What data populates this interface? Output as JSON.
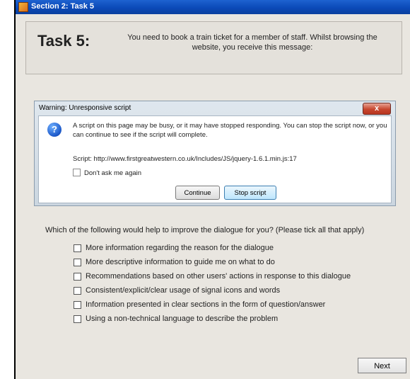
{
  "window": {
    "title": "Section 2: Task 5",
    "icon": "app-icon"
  },
  "task": {
    "label": "Task 5:",
    "description": "You need to book a train ticket for a member of staff.  Whilst browsing the website, you receive this message:"
  },
  "dialog": {
    "title": "Warning: Unresponsive script",
    "close_label": "x",
    "icon": "question-icon",
    "message": "A script on this page may be busy, or it may have stopped responding. You can stop the script now, or you can continue to see if the script will complete.",
    "script_line": "Script: http://www.firstgreatwestern.co.uk/Includes/JS/jquery-1.6.1.min.js:17",
    "dont_ask_label": "Don't ask me again",
    "dont_ask_checked": false,
    "continue_label": "Continue",
    "stop_label": "Stop script"
  },
  "survey": {
    "question": "Which of the following would help to improve the dialogue for you? (Please tick all that apply)",
    "options": [
      {
        "label": "More information regarding the reason for the dialogue",
        "checked": false
      },
      {
        "label": "More descriptive information to guide me on what to do",
        "checked": false
      },
      {
        "label": "Recommendations based on other users' actions in response to this dialogue",
        "checked": false
      },
      {
        "label": "Consistent/explicit/clear usage of signal icons and words",
        "checked": false
      },
      {
        "label": "Information presented in clear sections in the form of question/answer",
        "checked": false
      },
      {
        "label": "Using a non-technical language to describe the problem",
        "checked": false
      }
    ]
  },
  "footer": {
    "next_label": "Next"
  }
}
